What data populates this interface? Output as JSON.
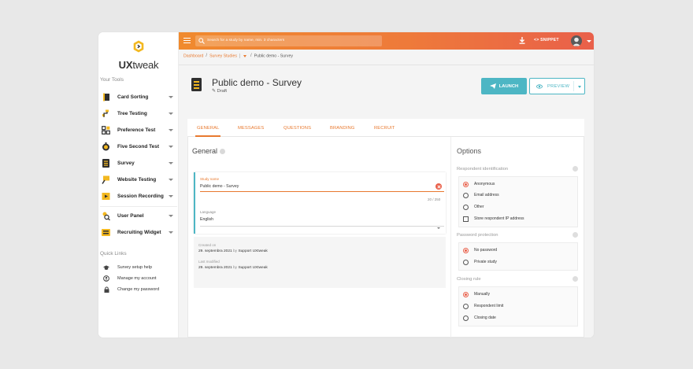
{
  "brand": {
    "name_prefix": "UX",
    "name_suffix": "tweak",
    "accent": "#e8792f",
    "teal": "#4db6c4"
  },
  "sidebar": {
    "section_tools": "Your Tools",
    "tools": [
      {
        "label": "Card Sorting",
        "icon": "card-sorting-icon"
      },
      {
        "label": "Tree Testing",
        "icon": "tree-testing-icon"
      },
      {
        "label": "Preference Test",
        "icon": "preference-test-icon"
      },
      {
        "label": "Five Second Test",
        "icon": "stopwatch-icon"
      },
      {
        "label": "Survey",
        "icon": "survey-icon"
      },
      {
        "label": "Website Testing",
        "icon": "website-testing-icon"
      },
      {
        "label": "Session Recording",
        "icon": "session-recording-icon"
      },
      {
        "label": "User Panel",
        "icon": "user-panel-icon"
      },
      {
        "label": "Recruiting Widget",
        "icon": "recruiting-widget-icon"
      }
    ],
    "section_quick": "Quick Links",
    "quick_links": [
      {
        "label": "Survey setup help",
        "icon": "graduation-cap-icon"
      },
      {
        "label": "Manage my account",
        "icon": "user-circle-icon"
      },
      {
        "label": "Change my password",
        "icon": "lock-icon"
      }
    ]
  },
  "topbar": {
    "search_placeholder": "Search for a study by name, min. 3 characters",
    "snippet_label": "<> SNIPPET"
  },
  "breadcrumb": {
    "dashboard": "Dashboard",
    "studies": "Survey Studies",
    "current": "Public demo - Survey"
  },
  "header": {
    "title": "Public demo - Survey",
    "status": "Draft",
    "launch_label": "LAUNCH",
    "preview_label": "PREVIEW"
  },
  "tabs": [
    "GENERAL",
    "MESSAGES",
    "QUESTIONS",
    "BRANDING",
    "RECRUIT"
  ],
  "general": {
    "heading": "General",
    "study_name_label": "Study name",
    "study_name_value": "Public demo - Survey",
    "char_counter": "20 / 250",
    "language_label": "Language",
    "language_value": "English",
    "created_label": "Created on",
    "created_date": "29. septembra 2021",
    "created_by": "by",
    "created_author": "Support UXtweak",
    "modified_label": "Last modified",
    "modified_date": "29. septembra 2021",
    "modified_by": "by",
    "modified_author": "Support UXtweak"
  },
  "options": {
    "heading": "Options",
    "respondent_title": "Respondent identification",
    "respondent_options": [
      "Anonymous",
      "Email address",
      "Other"
    ],
    "respondent_checkbox": "Store respondent IP address",
    "password_title": "Password protection",
    "password_options": [
      "No password",
      "Private study"
    ],
    "closing_title": "Closing rule",
    "closing_options": [
      "Manually",
      "Respondent limit",
      "Closing date"
    ]
  }
}
